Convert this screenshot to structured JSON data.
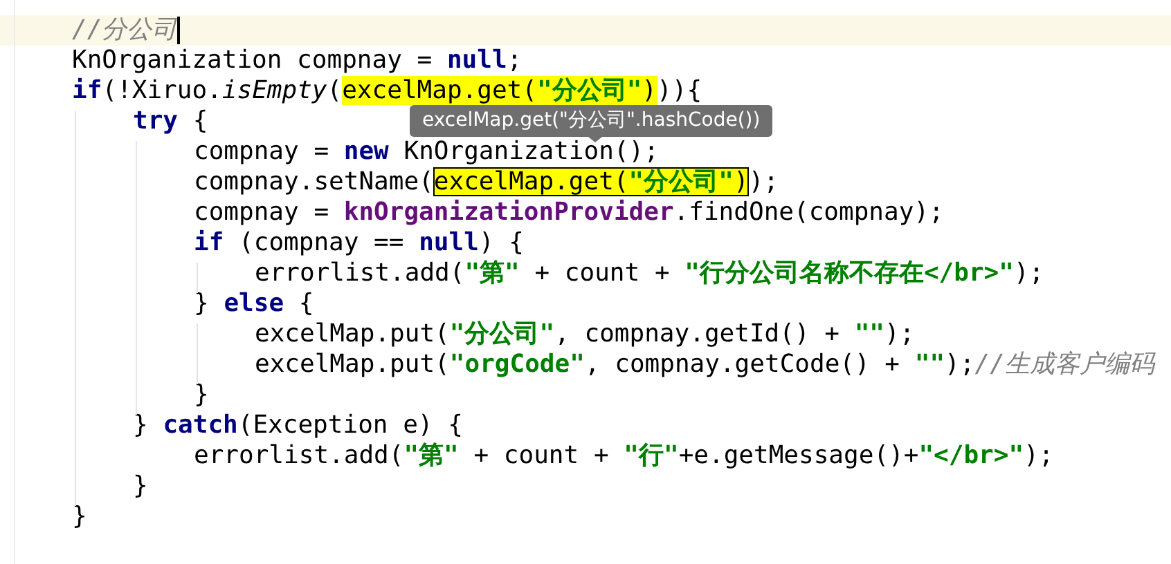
{
  "editor": {
    "lines": [
      {
        "current": true,
        "tokens": [
          {
            "kind": "comment",
            "text": "//分公司"
          }
        ]
      },
      {
        "current": false,
        "tokens": [
          {
            "kind": "plain",
            "text": "KnOrganization compnay = "
          },
          {
            "kind": "keyword",
            "text": "null"
          },
          {
            "kind": "plain",
            "text": ";"
          }
        ]
      },
      {
        "current": false,
        "tokens": [
          {
            "kind": "keyword",
            "text": "if"
          },
          {
            "kind": "plain",
            "text": "(!Xiruo."
          },
          {
            "kind": "static",
            "text": "isEmpty"
          },
          {
            "kind": "plain",
            "text": "("
          },
          {
            "kind": "match",
            "boxed": false,
            "parts": [
              {
                "kind": "plain",
                "text": "excelMap.get("
              },
              {
                "kind": "string",
                "text": "\"分公司\""
              },
              {
                "kind": "plain",
                "text": ")"
              }
            ]
          },
          {
            "kind": "plain",
            "text": ")){"
          }
        ],
        "children": [
          {
            "current": false,
            "tokens": [
              {
                "kind": "keyword",
                "text": "try"
              },
              {
                "kind": "plain",
                "text": " {"
              }
            ],
            "children": [
              {
                "current": false,
                "tokens": [
                  {
                    "kind": "plain",
                    "text": "compnay = "
                  },
                  {
                    "kind": "keyword",
                    "text": "new"
                  },
                  {
                    "kind": "plain",
                    "text": " KnOrganization();"
                  }
                ]
              },
              {
                "current": false,
                "tokens": [
                  {
                    "kind": "plain",
                    "text": "compnay.setName("
                  },
                  {
                    "kind": "match",
                    "boxed": true,
                    "parts": [
                      {
                        "kind": "plain",
                        "text": "excelMap.get("
                      },
                      {
                        "kind": "string",
                        "text": "\"分公司\""
                      },
                      {
                        "kind": "plain",
                        "text": ")"
                      }
                    ]
                  },
                  {
                    "kind": "plain",
                    "text": ");"
                  }
                ]
              },
              {
                "current": false,
                "tokens": [
                  {
                    "kind": "plain",
                    "text": "compnay = "
                  },
                  {
                    "kind": "field",
                    "text": "knOrganizationProvider"
                  },
                  {
                    "kind": "plain",
                    "text": ".findOne(compnay);"
                  }
                ]
              },
              {
                "current": false,
                "tokens": [
                  {
                    "kind": "keyword",
                    "text": "if"
                  },
                  {
                    "kind": "plain",
                    "text": " (compnay == "
                  },
                  {
                    "kind": "keyword",
                    "text": "null"
                  },
                  {
                    "kind": "plain",
                    "text": ") {"
                  }
                ],
                "children": [
                  {
                    "current": false,
                    "tokens": [
                      {
                        "kind": "plain",
                        "text": "errorlist.add("
                      },
                      {
                        "kind": "string",
                        "text": "\"第\""
                      },
                      {
                        "kind": "plain",
                        "text": " + count + "
                      },
                      {
                        "kind": "string",
                        "text": "\"行分公司名称不存在</br>\""
                      },
                      {
                        "kind": "plain",
                        "text": ");"
                      }
                    ]
                  }
                ]
              },
              {
                "current": false,
                "tokens": [
                  {
                    "kind": "plain",
                    "text": "} "
                  },
                  {
                    "kind": "keyword",
                    "text": "else"
                  },
                  {
                    "kind": "plain",
                    "text": " {"
                  }
                ],
                "children": [
                  {
                    "current": false,
                    "tokens": [
                      {
                        "kind": "plain",
                        "text": "excelMap.put("
                      },
                      {
                        "kind": "string",
                        "text": "\"分公司\""
                      },
                      {
                        "kind": "plain",
                        "text": ", compnay.getId() + "
                      },
                      {
                        "kind": "string",
                        "text": "\"\""
                      },
                      {
                        "kind": "plain",
                        "text": ");"
                      }
                    ]
                  },
                  {
                    "current": false,
                    "tokens": [
                      {
                        "kind": "plain",
                        "text": "excelMap.put("
                      },
                      {
                        "kind": "string",
                        "text": "\"orgCode\""
                      },
                      {
                        "kind": "plain",
                        "text": ", compnay.getCode() + "
                      },
                      {
                        "kind": "string",
                        "text": "\"\""
                      },
                      {
                        "kind": "plain",
                        "text": ");"
                      },
                      {
                        "kind": "comment",
                        "text": "//生成客户编码"
                      }
                    ]
                  }
                ]
              },
              {
                "current": false,
                "tokens": [
                  {
                    "kind": "plain",
                    "text": "}"
                  }
                ]
              }
            ]
          },
          {
            "current": false,
            "tokens": [
              {
                "kind": "plain",
                "text": "} "
              },
              {
                "kind": "keyword",
                "text": "catch"
              },
              {
                "kind": "plain",
                "text": "(Exception e) {"
              }
            ],
            "children": [
              {
                "current": false,
                "tokens": [
                  {
                    "kind": "plain",
                    "text": "errorlist.add("
                  },
                  {
                    "kind": "string",
                    "text": "\"第\""
                  },
                  {
                    "kind": "plain",
                    "text": " + count + "
                  },
                  {
                    "kind": "string",
                    "text": "\"行\""
                  },
                  {
                    "kind": "plain",
                    "text": "+e.getMessage()+"
                  },
                  {
                    "kind": "string",
                    "text": "\"</br>\""
                  },
                  {
                    "kind": "plain",
                    "text": ");"
                  }
                ]
              }
            ]
          },
          {
            "current": false,
            "tokens": [
              {
                "kind": "plain",
                "text": "}"
              }
            ]
          }
        ]
      },
      {
        "current": false,
        "tokens": [
          {
            "kind": "plain",
            "text": "}"
          }
        ]
      }
    ]
  },
  "tooltip": {
    "text": "excelMap.get(\"分公司\".hashCode())"
  }
}
